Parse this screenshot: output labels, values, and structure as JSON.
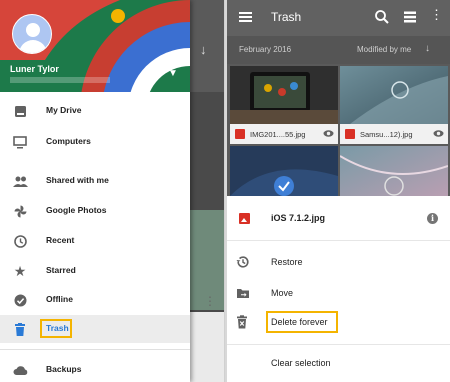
{
  "drawer": {
    "user_name": "Luner Tylor",
    "items": [
      {
        "label": "My Drive",
        "icon": "drive-icon"
      },
      {
        "label": "Computers",
        "icon": "computer-icon"
      },
      {
        "label": "Shared with me",
        "icon": "people-icon"
      },
      {
        "label": "Google Photos",
        "icon": "photos-pinwheel-icon"
      },
      {
        "label": "Recent",
        "icon": "clock-icon"
      },
      {
        "label": "Starred",
        "icon": "star-icon"
      },
      {
        "label": "Offline",
        "icon": "offline-check-icon"
      },
      {
        "label": "Trash",
        "icon": "trash-icon",
        "active": true
      },
      {
        "label": "Backups",
        "icon": "cloud-icon"
      }
    ],
    "colors": {
      "header_green": "#1d7a4a",
      "active_blue": "#2a7ad6",
      "highlight_box": "#f4b400"
    }
  },
  "appbar": {
    "title": "Trash",
    "icons": [
      "menu-icon",
      "search-icon",
      "list-view-icon",
      "more-vert-icon"
    ]
  },
  "subbar": {
    "date": "February 2016",
    "sort": "Modified by me",
    "sort_icon": "arrow-down-icon"
  },
  "files": [
    {
      "name": "IMG201....55.jpg"
    },
    {
      "name": "Samsu...12).jpg"
    }
  ],
  "sheet": {
    "file_name": "iOS 7.1.2.jpg",
    "actions": [
      {
        "label": "Restore",
        "icon": "restore-icon"
      },
      {
        "label": "Move",
        "icon": "move-folder-icon"
      },
      {
        "label": "Delete forever",
        "icon": "trash-icon",
        "highlighted": true
      },
      {
        "label": "Clear selection",
        "icon": ""
      }
    ]
  }
}
